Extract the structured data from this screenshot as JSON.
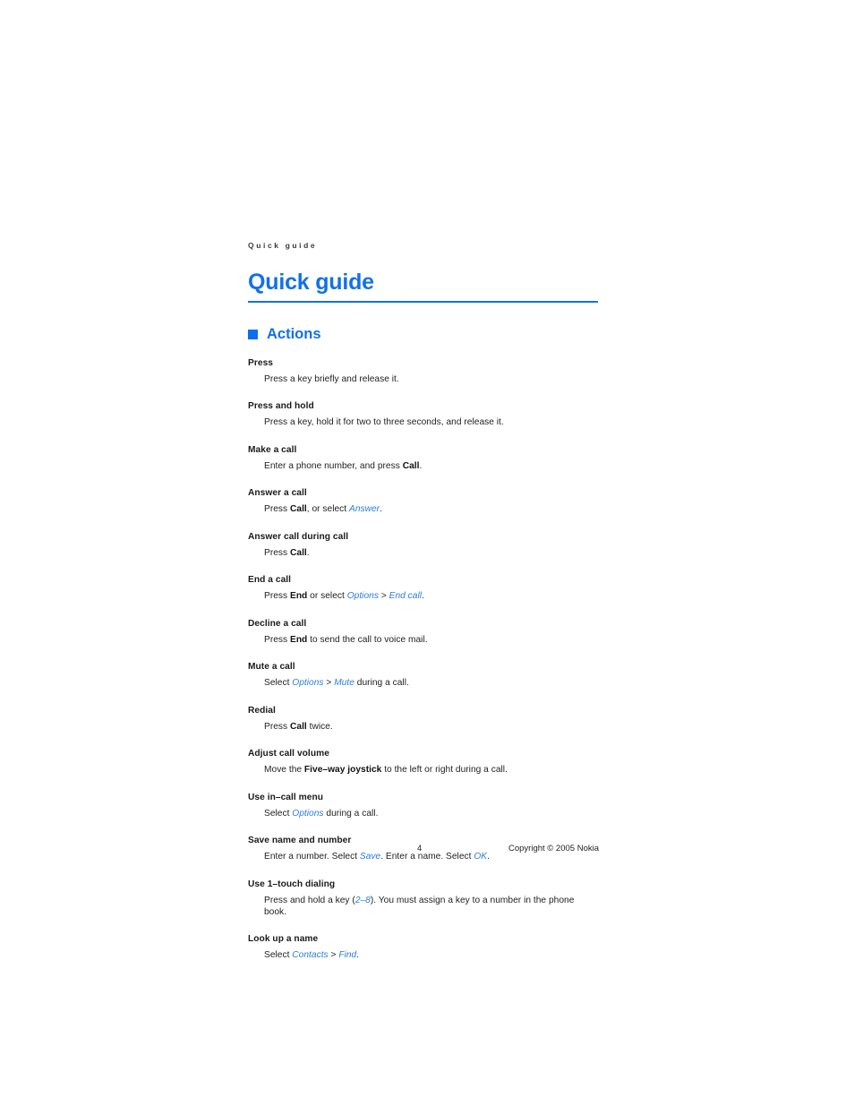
{
  "document": {
    "running_header": "Quick guide",
    "chapter_title": "Quick guide"
  },
  "section": {
    "title": "Actions",
    "bullet_color": "#0a6ef0",
    "accent_color": "#1271e8",
    "link_color": "#2b7de0"
  },
  "entries": [
    {
      "term": "Press",
      "definition": [
        {
          "text": "Press a key briefly and release it.",
          "style": "plain"
        }
      ]
    },
    {
      "term": "Press and hold",
      "definition": [
        {
          "text": "Press a key, hold it for two to three seconds, and release it.",
          "style": "plain"
        }
      ]
    },
    {
      "term": "Make a call",
      "definition": [
        {
          "text": "Enter a phone number, and press ",
          "style": "plain"
        },
        {
          "text": "Call",
          "style": "bold"
        },
        {
          "text": ".",
          "style": "plain"
        }
      ]
    },
    {
      "term": "Answer a call",
      "definition": [
        {
          "text": "Press ",
          "style": "plain"
        },
        {
          "text": "Call",
          "style": "bold"
        },
        {
          "text": ", or select ",
          "style": "plain"
        },
        {
          "text": "Answer",
          "style": "link"
        },
        {
          "text": ".",
          "style": "plain"
        }
      ]
    },
    {
      "term": "Answer call during call",
      "definition": [
        {
          "text": "Press ",
          "style": "plain"
        },
        {
          "text": "Call",
          "style": "bold"
        },
        {
          "text": ".",
          "style": "plain"
        }
      ]
    },
    {
      "term": "End a call",
      "definition": [
        {
          "text": "Press ",
          "style": "plain"
        },
        {
          "text": "End",
          "style": "bold"
        },
        {
          "text": " or select ",
          "style": "plain"
        },
        {
          "text": "Options",
          "style": "link"
        },
        {
          "text": " > ",
          "style": "sep"
        },
        {
          "text": "End call",
          "style": "link"
        },
        {
          "text": ".",
          "style": "plain"
        }
      ]
    },
    {
      "term": "Decline a call",
      "definition": [
        {
          "text": "Press ",
          "style": "plain"
        },
        {
          "text": "End",
          "style": "bold"
        },
        {
          "text": " to send the call to voice mail.",
          "style": "plain"
        }
      ]
    },
    {
      "term": "Mute a call",
      "definition": [
        {
          "text": "Select ",
          "style": "plain"
        },
        {
          "text": "Options",
          "style": "link"
        },
        {
          "text": " > ",
          "style": "sep"
        },
        {
          "text": "Mute",
          "style": "link"
        },
        {
          "text": " during a call.",
          "style": "plain"
        }
      ]
    },
    {
      "term": "Redial",
      "definition": [
        {
          "text": "Press ",
          "style": "plain"
        },
        {
          "text": "Call",
          "style": "bold"
        },
        {
          "text": " twice.",
          "style": "plain"
        }
      ]
    },
    {
      "term": "Adjust call volume",
      "definition": [
        {
          "text": "Move the ",
          "style": "plain"
        },
        {
          "text": "Five–way joystick",
          "style": "bold"
        },
        {
          "text": " to the left or right during a call.",
          "style": "plain"
        }
      ]
    },
    {
      "term": "Use in–call menu",
      "definition": [
        {
          "text": "Select ",
          "style": "plain"
        },
        {
          "text": "Options",
          "style": "link"
        },
        {
          "text": " during a call.",
          "style": "plain"
        }
      ]
    },
    {
      "term": "Save name and number",
      "definition": [
        {
          "text": "Enter a number. Select ",
          "style": "plain"
        },
        {
          "text": "Save",
          "style": "link"
        },
        {
          "text": ". Enter a name. Select ",
          "style": "plain"
        },
        {
          "text": "OK",
          "style": "link"
        },
        {
          "text": ".",
          "style": "plain"
        }
      ]
    },
    {
      "term": "Use 1–touch dialing",
      "definition": [
        {
          "text": "Press and hold a key (",
          "style": "plain"
        },
        {
          "text": "2–8",
          "style": "link"
        },
        {
          "text": "). You must assign a key to a number in the phone book.",
          "style": "plain"
        }
      ]
    },
    {
      "term": "Look up a name",
      "definition": [
        {
          "text": "Select ",
          "style": "plain"
        },
        {
          "text": "Contacts",
          "style": "link"
        },
        {
          "text": " > ",
          "style": "sep"
        },
        {
          "text": "Find",
          "style": "link"
        },
        {
          "text": ".",
          "style": "plain"
        }
      ]
    }
  ],
  "footer": {
    "page_number": "4",
    "copyright": "Copyright © 2005 Nokia"
  }
}
